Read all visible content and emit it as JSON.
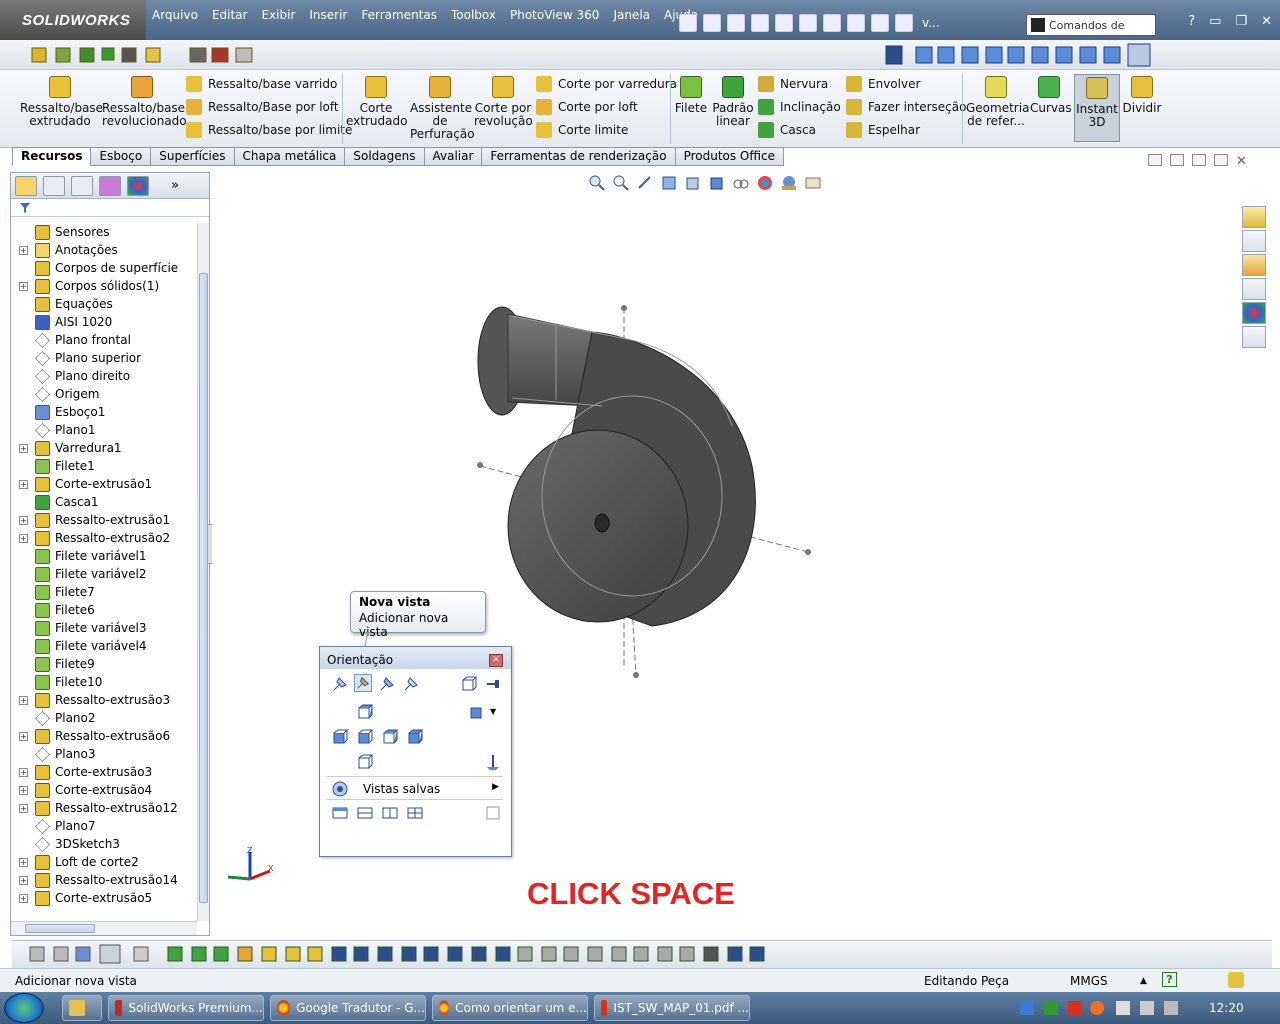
{
  "app": {
    "logo": "SOLIDWORKS",
    "menu": [
      "Arquivo",
      "Editar",
      "Exibir",
      "Inserir",
      "Ferramentas",
      "Toolbox",
      "PhotoView 360",
      "Janela",
      "Ajuda"
    ],
    "search_placeholder": "Comandos de",
    "overflow_label": "v...",
    "help_label": "?"
  },
  "commandmanager": {
    "big_buttons": [
      {
        "label": "Ressalto/base extrudado",
        "icon": "extruded-boss-icon"
      },
      {
        "label": "Ressalto/base revolucionado",
        "icon": "revolved-boss-icon"
      },
      {
        "label": "Corte extrudado",
        "icon": "extruded-cut-icon"
      },
      {
        "label": "Assistente de Perfuração",
        "icon": "hole-wizard-icon"
      },
      {
        "label": "Corte por revolução",
        "icon": "revolved-cut-icon"
      },
      {
        "label": "Filete",
        "icon": "fillet-icon"
      },
      {
        "label": "Padrão linear",
        "icon": "linear-pattern-icon"
      },
      {
        "label": "Geometria de refer...",
        "icon": "reference-geometry-icon"
      },
      {
        "label": "Curvas",
        "icon": "curves-icon"
      },
      {
        "label": "Instant 3D",
        "icon": "instant3d-icon"
      },
      {
        "label": "Dividir",
        "icon": "split-icon"
      }
    ],
    "small_buttons": [
      {
        "label": "Ressalto/base varrido",
        "icon": "swept-boss-icon"
      },
      {
        "label": "Ressalto/Base por loft",
        "icon": "lofted-boss-icon"
      },
      {
        "label": "Ressalto/base por limite",
        "icon": "boundary-boss-icon"
      },
      {
        "label": "Corte por varredura",
        "icon": "swept-cut-icon"
      },
      {
        "label": "Corte por loft",
        "icon": "lofted-cut-icon"
      },
      {
        "label": "Corte limite",
        "icon": "boundary-cut-icon"
      },
      {
        "label": "Nervura",
        "icon": "rib-icon"
      },
      {
        "label": "Inclinação",
        "icon": "draft-icon"
      },
      {
        "label": "Casca",
        "icon": "shell-icon"
      },
      {
        "label": "Envolver",
        "icon": "wrap-icon"
      },
      {
        "label": "Fazer interseção",
        "icon": "intersect-icon"
      },
      {
        "label": "Espelhar",
        "icon": "mirror-icon"
      }
    ],
    "tabs": [
      "Recursos",
      "Esboço",
      "Superfícies",
      "Chapa metálica",
      "Soldagens",
      "Avaliar",
      "Ferramentas de renderização",
      "Produtos Office"
    ],
    "active_tab": "Recursos"
  },
  "feature_tree": [
    {
      "label": "Sensores",
      "icon": "sensor-icon",
      "expandable": false
    },
    {
      "label": "Anotações",
      "icon": "annotations-icon",
      "expandable": true
    },
    {
      "label": "Corpos de superfície",
      "icon": "surface-bodies-icon",
      "expandable": false
    },
    {
      "label": "Corpos sólidos(1)",
      "icon": "solid-bodies-icon",
      "expandable": true
    },
    {
      "label": "Equações",
      "icon": "equations-icon",
      "expandable": false
    },
    {
      "label": "AISI 1020",
      "icon": "material-icon",
      "expandable": false
    },
    {
      "label": "Plano frontal",
      "icon": "plane-icon",
      "expandable": false
    },
    {
      "label": "Plano superior",
      "icon": "plane-icon",
      "expandable": false
    },
    {
      "label": "Plano direito",
      "icon": "plane-icon",
      "expandable": false
    },
    {
      "label": "Origem",
      "icon": "origin-icon",
      "expandable": false
    },
    {
      "label": "Esboço1",
      "icon": "sketch-icon",
      "expandable": false
    },
    {
      "label": "Plano1",
      "icon": "plane-icon",
      "expandable": false
    },
    {
      "label": "Varredura1",
      "icon": "sweep-icon",
      "expandable": true
    },
    {
      "label": "Filete1",
      "icon": "fillet-icon",
      "expandable": false
    },
    {
      "label": "Corte-extrusão1",
      "icon": "cut-extrude-icon",
      "expandable": true
    },
    {
      "label": "Casca1",
      "icon": "shell-icon",
      "expandable": false
    },
    {
      "label": "Ressalto-extrusão1",
      "icon": "boss-extrude-icon",
      "expandable": true
    },
    {
      "label": "Ressalto-extrusão2",
      "icon": "boss-extrude-icon",
      "expandable": true
    },
    {
      "label": "Filete variável1",
      "icon": "fillet-icon",
      "expandable": false
    },
    {
      "label": "Filete variável2",
      "icon": "fillet-icon",
      "expandable": false
    },
    {
      "label": "Filete7",
      "icon": "fillet-icon",
      "expandable": false
    },
    {
      "label": "Filete6",
      "icon": "fillet-icon",
      "expandable": false
    },
    {
      "label": "Filete variável3",
      "icon": "fillet-icon",
      "expandable": false
    },
    {
      "label": "Filete variável4",
      "icon": "fillet-icon",
      "expandable": false
    },
    {
      "label": "Filete9",
      "icon": "fillet-icon",
      "expandable": false
    },
    {
      "label": "Filete10",
      "icon": "fillet-icon",
      "expandable": false
    },
    {
      "label": "Ressalto-extrusão3",
      "icon": "boss-extrude-icon",
      "expandable": true
    },
    {
      "label": "Plano2",
      "icon": "plane-icon",
      "expandable": false
    },
    {
      "label": "Ressalto-extrusão6",
      "icon": "boss-extrude-icon",
      "expandable": true
    },
    {
      "label": "Plano3",
      "icon": "plane-icon",
      "expandable": false
    },
    {
      "label": "Corte-extrusão3",
      "icon": "cut-extrude-icon",
      "expandable": true
    },
    {
      "label": "Corte-extrusão4",
      "icon": "cut-extrude-icon",
      "expandable": true
    },
    {
      "label": "Ressalto-extrusão12",
      "icon": "boss-extrude-icon",
      "expandable": true
    },
    {
      "label": "Plano7",
      "icon": "plane-icon",
      "expandable": false
    },
    {
      "label": "3DSketch3",
      "icon": "sketch3d-icon",
      "expandable": false
    },
    {
      "label": "Loft de corte2",
      "icon": "cut-loft-icon",
      "expandable": true
    },
    {
      "label": "Ressalto-extrusão14",
      "icon": "boss-extrude-icon",
      "expandable": true
    },
    {
      "label": "Corte-extrusão5",
      "icon": "cut-extrude-icon",
      "expandable": true
    }
  ],
  "tooltip": {
    "title": "Nova vista",
    "body": "Adicionar nova vista"
  },
  "orientation_dialog": {
    "title": "Orientação",
    "saved_views_label": "Vistas salvas"
  },
  "overlay_text": "CLICK SPACE",
  "triad": {
    "x": "X",
    "y": "Y",
    "z": "Z"
  },
  "status": {
    "left": "Adicionar nova vista",
    "mode": "Editando Peça",
    "units": "MMGS"
  },
  "taskbar": {
    "items": [
      "SolidWorks Premium...",
      "Google Tradutor - G...",
      "Como orientar um e...",
      "IST_SW_MAP_01.pdf ..."
    ],
    "clock": "12:20"
  },
  "colors": {
    "accent": "#e52323",
    "model": "#5a5a5a"
  }
}
